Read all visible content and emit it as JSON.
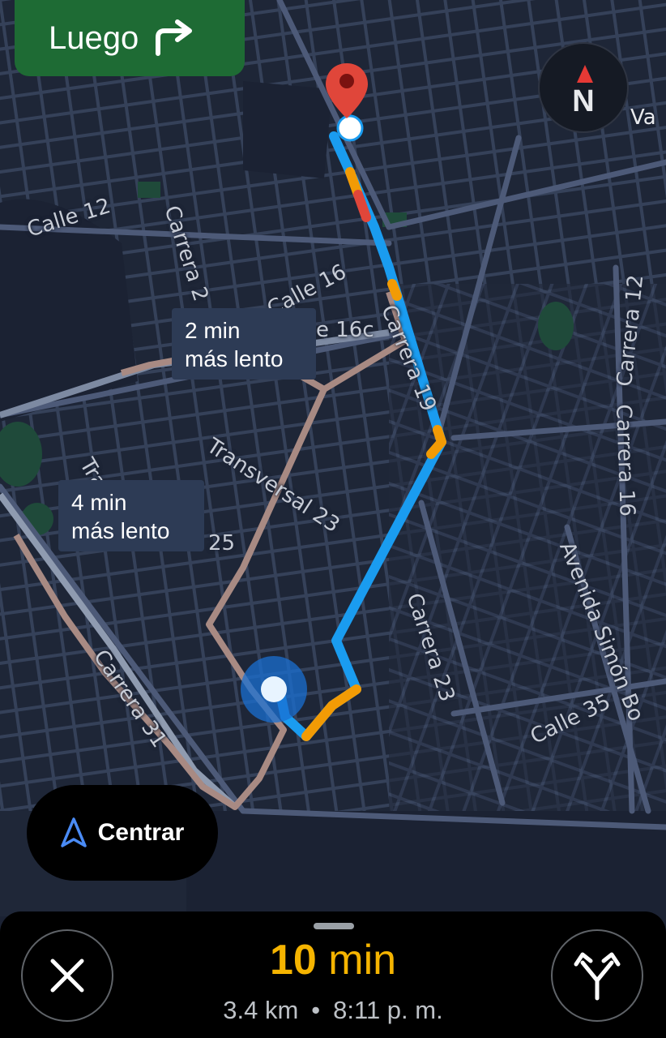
{
  "navigation": {
    "next_label": "Luego",
    "next_turn_icon": "turn-right-icon"
  },
  "compass": {
    "label": "N"
  },
  "street_labels": {
    "calle_12": "Calle 12",
    "carrera_2x": "Carrera 2",
    "calle_16": "Calle 16",
    "calle_16c": "e 16c",
    "carrera_19": "Carrera 19",
    "transversal_23": "Transversal 23",
    "tra": "Tra",
    "num_25": "25",
    "carrera_31": "Carrera 31",
    "carrera_23": "Carrera 23",
    "carrera_12": "Carrera 12",
    "carrera_16": "Carrera 16",
    "avenida_simon": "Avenida Simón Bo",
    "calle_35": "Calle 35",
    "va": "Va"
  },
  "alternatives": [
    {
      "line1": "2 min",
      "line2": "más lento"
    },
    {
      "line1": "4 min",
      "line2": "más lento"
    }
  ],
  "recenter": {
    "label": "Centrar"
  },
  "trip": {
    "duration_value": "10",
    "duration_unit": "min",
    "distance": "3.4 km",
    "separator": "•",
    "arrival": "8:11 p. m."
  },
  "colors": {
    "map_bg": "#1b2233",
    "route_blue": "#1a9cf0",
    "traffic_orange": "#f29b05",
    "traffic_red": "#e0463a",
    "alt_route": "#a88a83",
    "turn_banner": "#1e6b34",
    "eta": "#f5b400"
  }
}
